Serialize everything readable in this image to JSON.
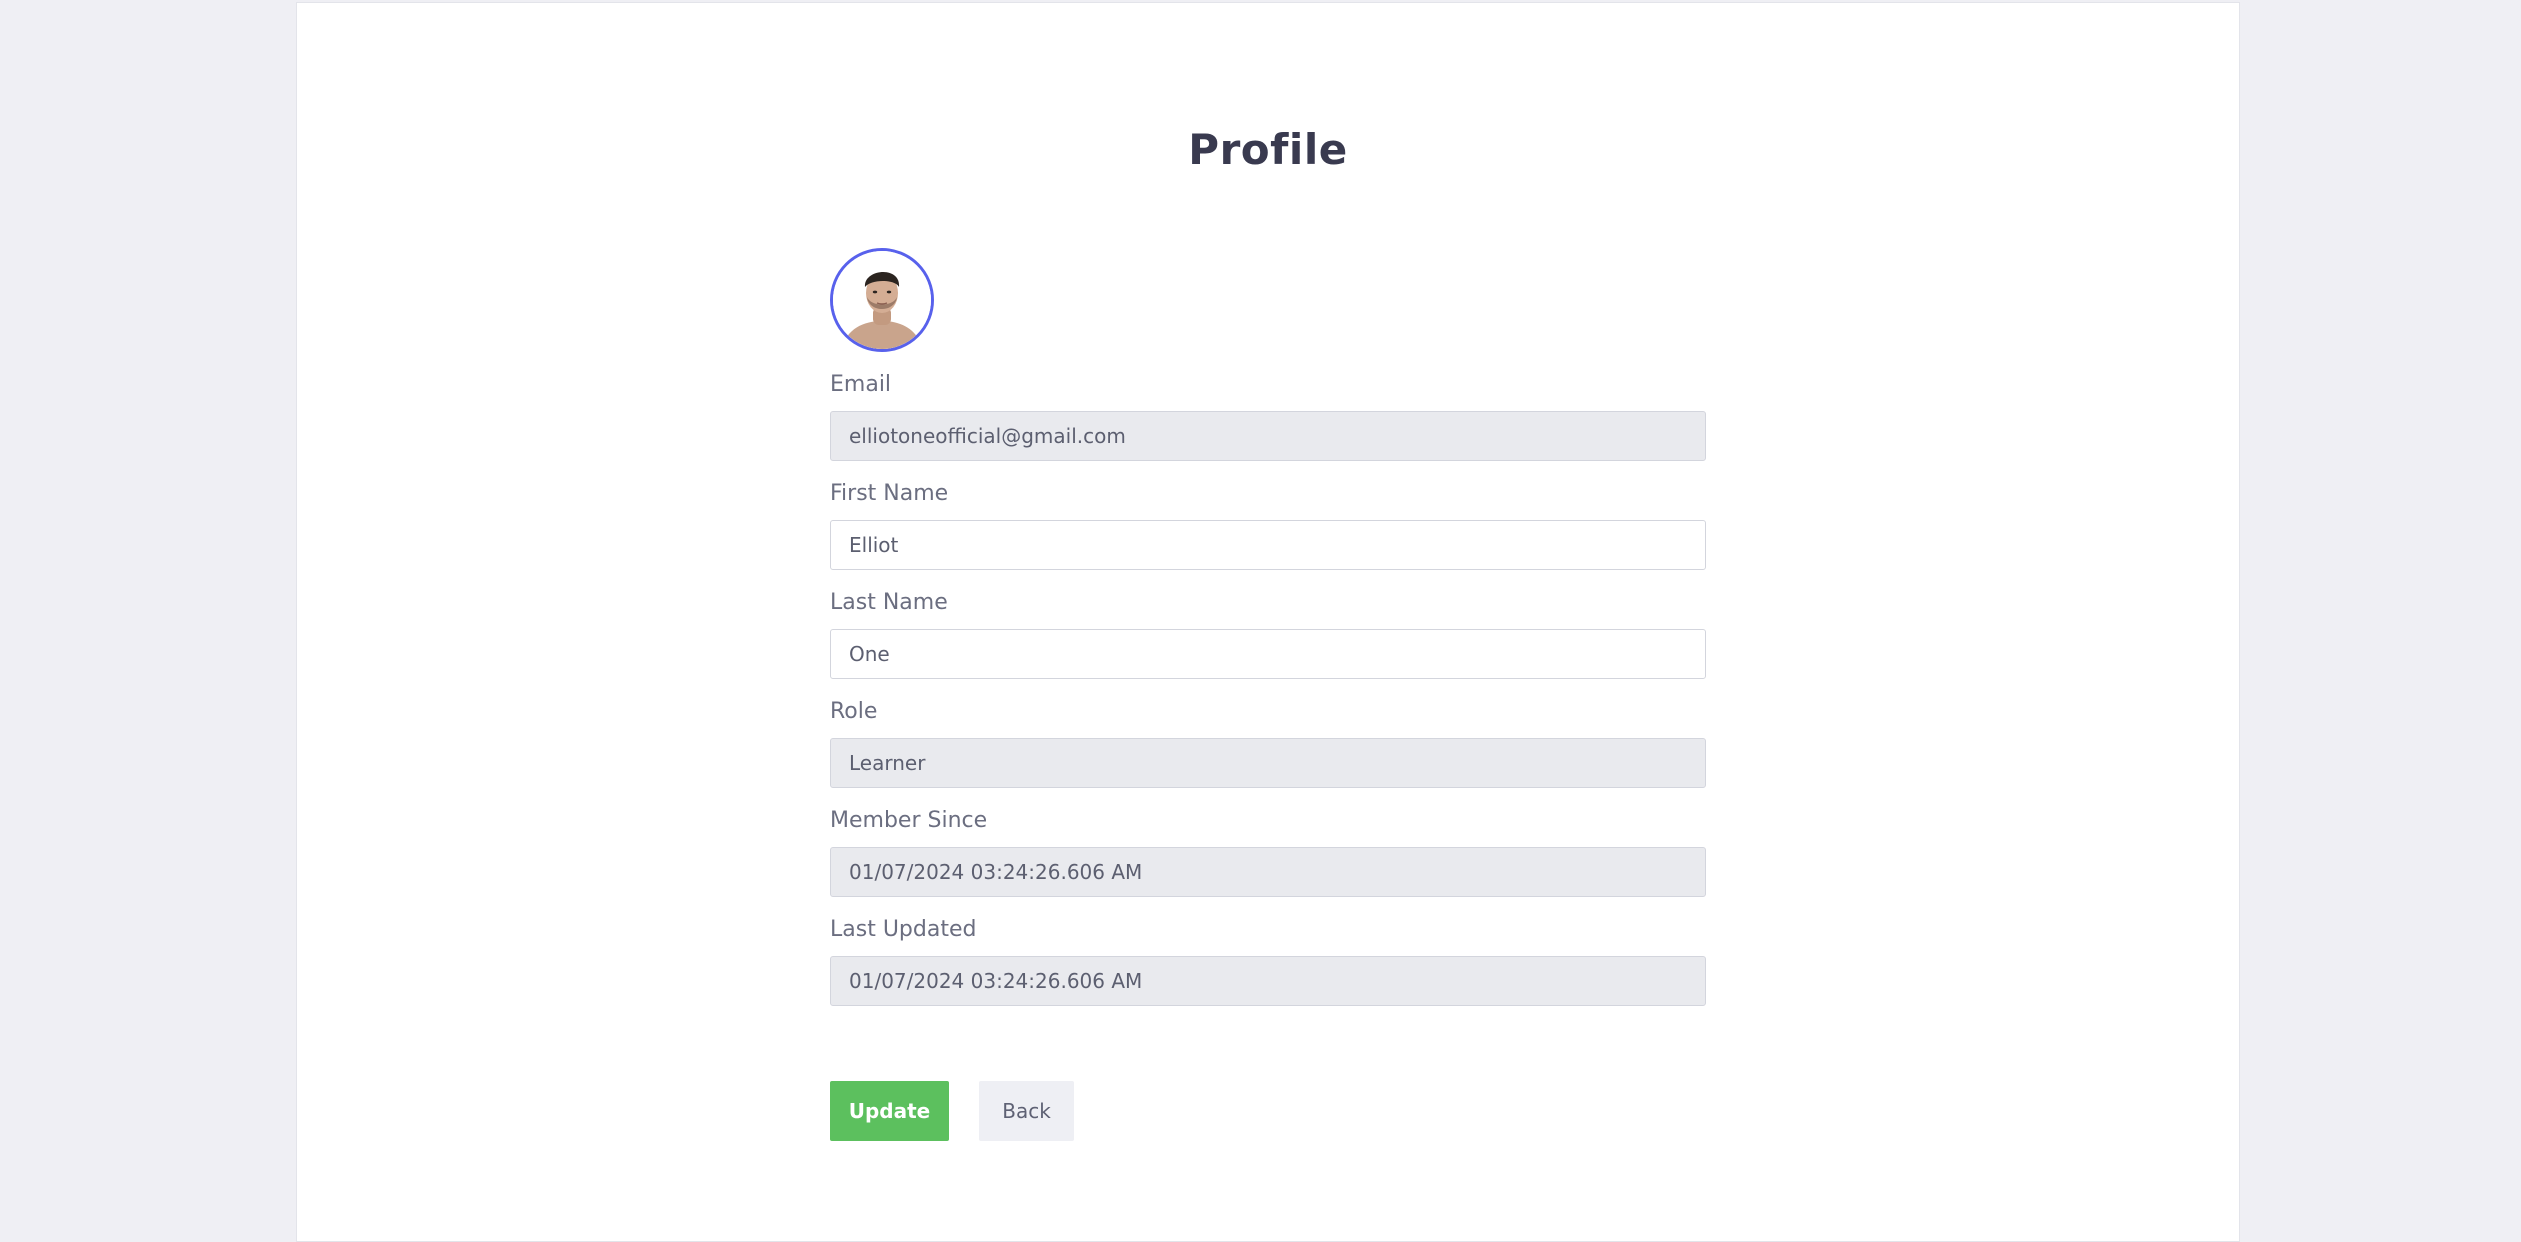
{
  "page": {
    "title": "Profile"
  },
  "profile": {
    "fields": [
      {
        "label": "Email",
        "value": "elliotoneofficial@gmail.com",
        "readonly": true
      },
      {
        "label": "First Name",
        "value": "Elliot",
        "readonly": false
      },
      {
        "label": "Last Name",
        "value": "One",
        "readonly": false
      },
      {
        "label": "Role",
        "value": "Learner",
        "readonly": true
      },
      {
        "label": "Member Since",
        "value": "01/07/2024 03:24:26.606 AM",
        "readonly": true
      },
      {
        "label": "Last Updated",
        "value": "01/07/2024 03:24:26.606 AM",
        "readonly": true
      }
    ]
  },
  "actions": {
    "update_label": "Update",
    "back_label": "Back"
  },
  "colors": {
    "accent": "#5861ec",
    "update_button": "#5cc05e",
    "title_text": "#393a4f"
  }
}
